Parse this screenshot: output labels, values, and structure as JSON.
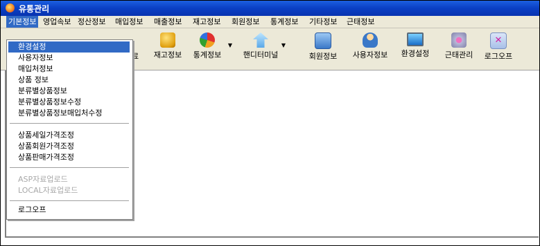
{
  "window": {
    "title": "유통관리"
  },
  "menubar": [
    "기본정보",
    "영업속보",
    "정산정보",
    "매입정보",
    "매출정보",
    "재고정보",
    "회원정보",
    "통계정보",
    "기타정보",
    "근태정보"
  ],
  "toolbar": {
    "partial_label": "료",
    "buttons": [
      "재고정보",
      "통계정보",
      "핸디터미널",
      "회원정보",
      "사용자정보",
      "환경설정",
      "근태관리",
      "로그오프"
    ]
  },
  "dropdown": {
    "group1": [
      "환경설정",
      "사용자정보",
      "매입처정보",
      "상품  정보",
      "분류별상품정보",
      "분류별상품정보수정",
      "분류별상품정보매입처수정"
    ],
    "group2": [
      "상품세일가격조정",
      "상품회원가격조정",
      "상품판매가격조정"
    ],
    "group3": [
      "ASP자료업로드",
      "LOCAL자료업로드"
    ],
    "group4": [
      "로그오프"
    ]
  }
}
